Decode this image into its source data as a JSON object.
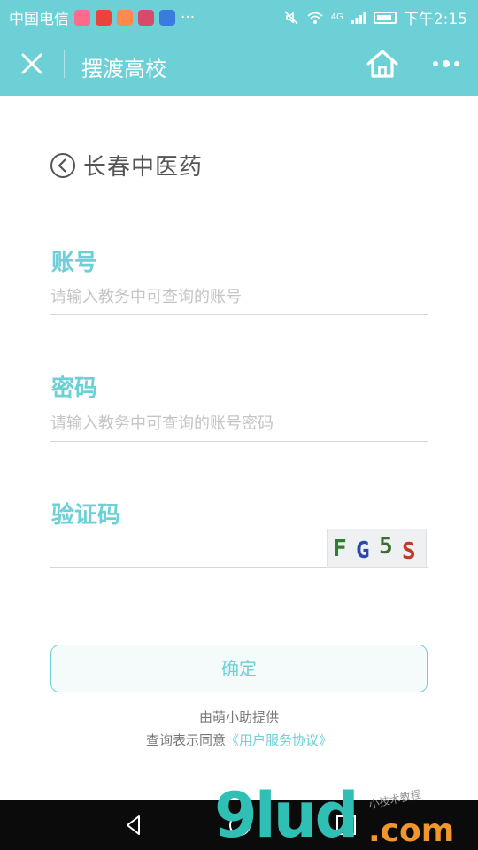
{
  "status_bar": {
    "carrier": "中国电信",
    "extra_icons_label": "···",
    "network": "4G",
    "time": "下午2:15"
  },
  "nav": {
    "title": "摆渡高校",
    "close_icon": "close-icon",
    "home_icon": "home-icon",
    "more_icon": "more-icon"
  },
  "school": {
    "name": "长春中医药"
  },
  "form": {
    "account_label": "账号",
    "account_placeholder": "请输入教务中可查询的账号",
    "password_label": "密码",
    "password_placeholder": "请输入教务中可查询的账号密码",
    "captcha_label": "验证码",
    "captcha_value": "",
    "captcha_chars": [
      {
        "ch": "F",
        "color": "#2f7d32"
      },
      {
        "ch": "G",
        "color": "#2b4aa8"
      },
      {
        "ch": "5",
        "color": "#3a6d2f"
      },
      {
        "ch": "S",
        "color": "#c0392b"
      }
    ]
  },
  "actions": {
    "confirm_label": "确定"
  },
  "footer": {
    "provider": "由萌小助提供",
    "agreement_prefix": "查询表示同意",
    "agreement_link": "《用户服务协议》"
  },
  "watermark": {
    "big": "9lud",
    "com": ".com",
    "small": "小技术教程"
  },
  "colors": {
    "accent": "#6cd0d6",
    "placeholder": "#c4c4c4",
    "divider": "#d6d6d6"
  }
}
